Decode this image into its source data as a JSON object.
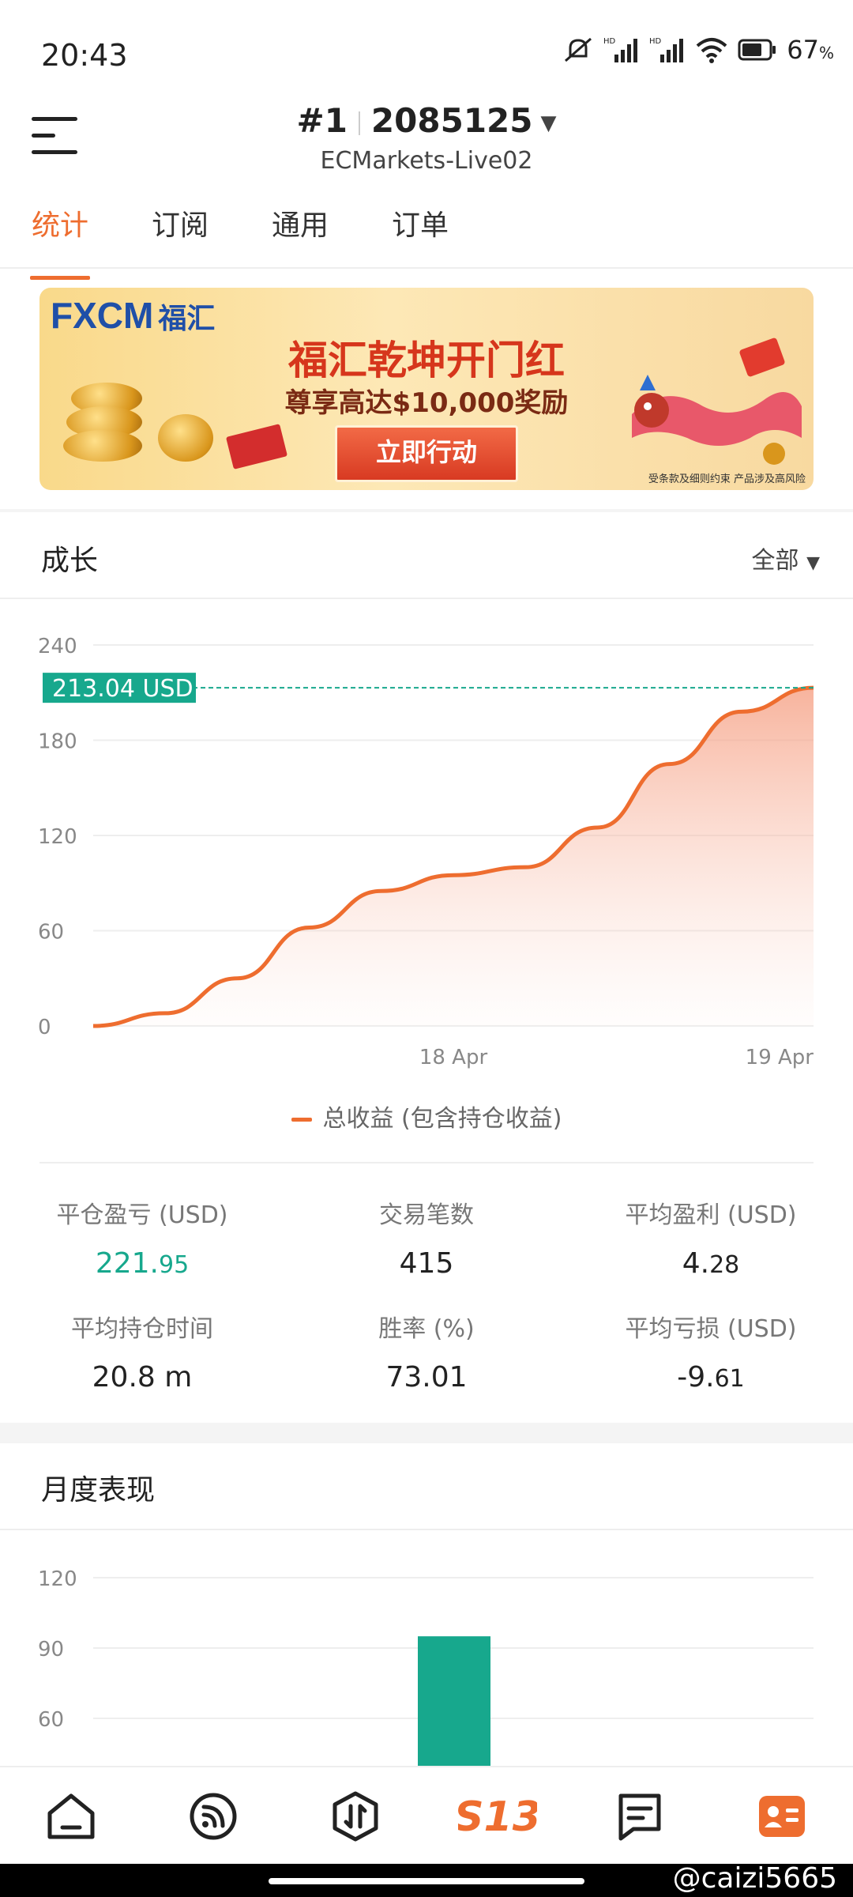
{
  "status_bar": {
    "time": "20:43",
    "battery": "67",
    "battery_unit": "%",
    "icons": [
      "mute-icon",
      "signal-hd-icon",
      "signal-hd-icon",
      "wifi-icon",
      "battery-icon"
    ]
  },
  "header": {
    "account_number": "#1",
    "account_id": "2085125",
    "server": "ECMarkets-Live02"
  },
  "tabs": [
    {
      "label": "统计",
      "active": true
    },
    {
      "label": "订阅",
      "active": false
    },
    {
      "label": "通用",
      "active": false
    },
    {
      "label": "订单",
      "active": false
    }
  ],
  "banner": {
    "brand": "FXCM",
    "brand_cn": "福汇",
    "headline": "福汇乾坤开门红",
    "subline": "尊享高达$10,000奖励",
    "cta": "立即行动",
    "disclaimer": "受条款及细则约束  产品涉及高风险"
  },
  "growth": {
    "title": "成长",
    "filter": "全部",
    "current_label": "213.04 USD",
    "legend": "总收益 (包含持仓收益)"
  },
  "chart_data": [
    {
      "type": "area",
      "ylim": [
        0,
        240
      ],
      "y_ticks": [
        "0",
        "60",
        "120",
        "180",
        "240"
      ],
      "x_ticks": [
        "18 Apr",
        "19 Apr"
      ],
      "series": [
        {
          "name": "总收益 (包含持仓收益)",
          "color": "#ee6d2f",
          "x": [
            0,
            0.1,
            0.2,
            0.3,
            0.4,
            0.5,
            0.6,
            0.7,
            0.8,
            0.9,
            1.0
          ],
          "values": [
            0,
            8,
            30,
            62,
            85,
            95,
            100,
            125,
            165,
            198,
            213.04
          ]
        }
      ],
      "reference_line": {
        "value": 213.04,
        "color": "#17a88d"
      }
    },
    {
      "type": "bar",
      "ylim": [
        60,
        120
      ],
      "y_ticks": [
        "60",
        "90",
        "120"
      ],
      "categories": [
        ""
      ],
      "values": [
        95
      ],
      "color": "#17a88d"
    }
  ],
  "stats": [
    {
      "label": "平仓盈亏 (USD)",
      "value_main": "221.",
      "value_frac": "95",
      "color": "green"
    },
    {
      "label": "交易笔数",
      "value_main": "415",
      "value_frac": "",
      "color": "normal"
    },
    {
      "label": "平均盈利 (USD)",
      "value_main": "4.",
      "value_frac": "28",
      "color": "normal"
    },
    {
      "label": "平均持仓时间",
      "value_main": "20.8 m",
      "value_frac": "",
      "color": "normal"
    },
    {
      "label": "胜率 (%)",
      "value_main": "73.01",
      "value_frac": "",
      "color": "normal"
    },
    {
      "label": "平均亏损 (USD)",
      "value_main": "-9.",
      "value_frac": "61",
      "color": "normal"
    }
  ],
  "monthly": {
    "title": "月度表现"
  },
  "bottom_nav": [
    {
      "name": "home-icon"
    },
    {
      "name": "signal-icon"
    },
    {
      "name": "trade-icon"
    },
    {
      "name": "s13-logo-icon",
      "label": "S13"
    },
    {
      "name": "message-icon"
    },
    {
      "name": "profile-icon"
    }
  ],
  "watermark": "@caizi5665"
}
